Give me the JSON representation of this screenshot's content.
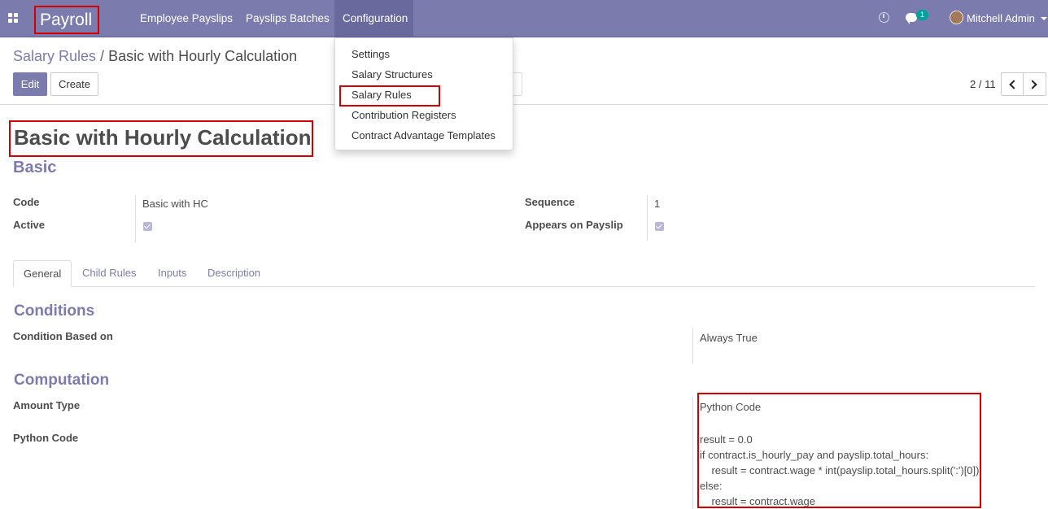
{
  "nav": {
    "brand": "Payroll",
    "menus": [
      "Employee Payslips",
      "Payslips Batches",
      "Configuration"
    ],
    "chat_badge": "1",
    "user_name": "Mitchell Admin"
  },
  "dropdown": {
    "items": [
      "Settings",
      "Salary Structures",
      "Salary Rules",
      "Contribution Registers",
      "Contract Advantage Templates"
    ],
    "highlighted": "Salary Rules"
  },
  "breadcrumb": {
    "parent": "Salary Rules",
    "separator": "/",
    "current": "Basic with Hourly Calculation"
  },
  "buttons": {
    "edit": "Edit",
    "create": "Create"
  },
  "pager": {
    "value": "2 / 11"
  },
  "record": {
    "name": "Basic with Hourly Calculation",
    "category": "Basic",
    "code_label": "Code",
    "code_value": "Basic with HC",
    "active_label": "Active",
    "active_checked": true,
    "sequence_label": "Sequence",
    "sequence_value": "1",
    "appears_label": "Appears on Payslip",
    "appears_checked": true
  },
  "tabs": [
    "General",
    "Child Rules",
    "Inputs",
    "Description"
  ],
  "active_tab": "General",
  "conditions": {
    "title": "Conditions",
    "based_on_label": "Condition Based on",
    "based_on_value": "Always True"
  },
  "computation": {
    "title": "Computation",
    "amount_type_label": "Amount Type",
    "amount_type_value": "Python Code",
    "python_code_label": "Python Code",
    "code_lines": [
      "result = 0.0",
      "if contract.is_hourly_pay and payslip.total_hours:",
      "    result = contract.wage * int(payslip.total_hours.split(':')[0])",
      "else:",
      "    result = contract.wage"
    ]
  },
  "colors": {
    "brand": "#7c7bad",
    "highlight": "#d40000",
    "badge": "#00a09d"
  }
}
